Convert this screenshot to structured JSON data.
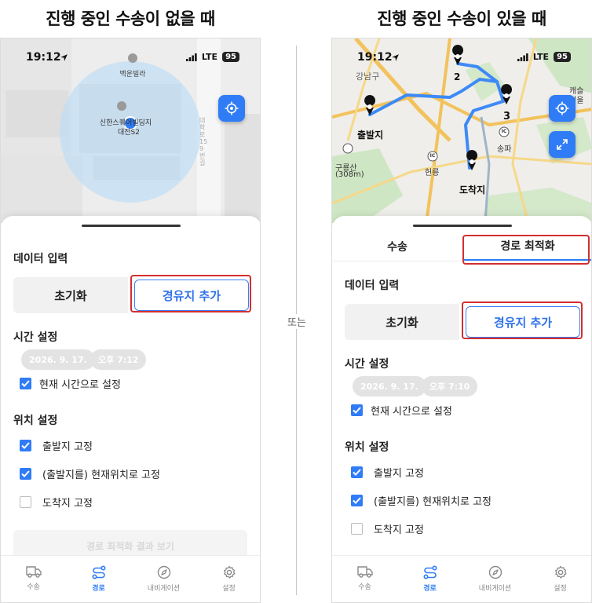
{
  "left": {
    "heading": "진행 중인 수송이 없을 때",
    "status": {
      "time": "19:12",
      "network": "LTE",
      "battery": "95"
    },
    "map": {
      "labels": [
        "백운빌라",
        "신한스퀘어빌딩지",
        "대전S2",
        "대학로159번길"
      ]
    },
    "section_data": "데이터 입력",
    "reset_label": "초기화",
    "add_label": "경유지 추가",
    "section_time": "시간 설정",
    "date_chip": "2026. 9. 17.",
    "time_chip": "오후 7:12",
    "current_time_label": "현재 시간으로 설정",
    "section_location": "위치 설정",
    "checks": [
      {
        "label": "출발지 고정",
        "checked": true
      },
      {
        "label": "(출발지를) 현재위치로 고정",
        "checked": true
      },
      {
        "label": "도착지 고정",
        "checked": false
      }
    ],
    "ghost_button": "경로 최적화 결과 보기"
  },
  "right": {
    "heading": "진행 중인 수송이 있을 때",
    "status": {
      "time": "19:12",
      "network": "LTE",
      "battery": "95"
    },
    "map": {
      "labels": [
        "강남구",
        "출발지",
        "구룡산",
        "(308m)",
        "헌릉",
        "송파",
        "도착지",
        "캐슬",
        "서울",
        "3",
        "2",
        "IC",
        "IC"
      ]
    },
    "top_tabs": [
      {
        "label": "수송"
      },
      {
        "label": "경로 최적화"
      }
    ],
    "section_data": "데이터 입력",
    "reset_label": "초기화",
    "add_label": "경유지 추가",
    "section_time": "시간 설정",
    "date_chip": "2026. 9. 17.",
    "time_chip": "오후 7:10",
    "current_time_label": "현재 시간으로 설정",
    "section_location": "위치 설정",
    "checks": [
      {
        "label": "출발지 고정",
        "checked": true
      },
      {
        "label": "(출발지를) 현재위치로 고정",
        "checked": true
      },
      {
        "label": "도착지 고정",
        "checked": false
      }
    ]
  },
  "or_label": "또는",
  "tabbar": [
    {
      "label": "수송",
      "icon": "truck-icon",
      "active": false
    },
    {
      "label": "경로",
      "icon": "route-icon",
      "active": true
    },
    {
      "label": "내비게이션",
      "icon": "compass-icon",
      "active": false
    },
    {
      "label": "설정",
      "icon": "gear-icon",
      "active": false
    }
  ],
  "colors": {
    "accent": "#2f7cf6",
    "highlight": "#d32f2f",
    "route": "#3d8af7"
  }
}
